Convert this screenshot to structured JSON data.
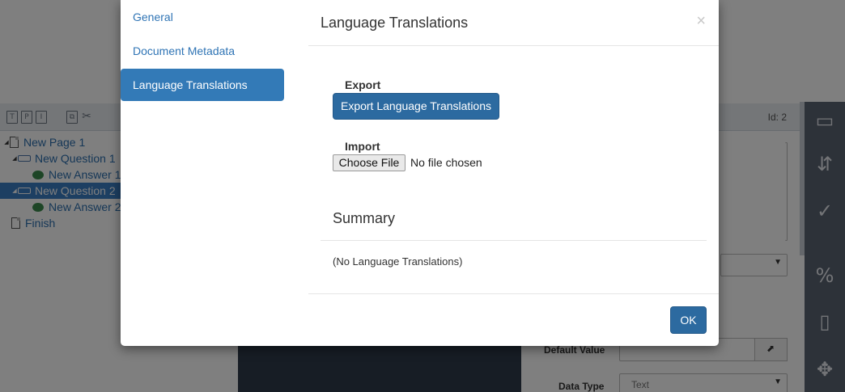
{
  "app": {
    "toolbar": {
      "icons": [
        "T",
        "P",
        "I",
        "copy",
        "cut",
        "T"
      ],
      "id_label": "Id: 2"
    },
    "tree": [
      {
        "label": "New Page 1",
        "type": "page",
        "depth": 0,
        "expanded": true,
        "selected": false
      },
      {
        "label": "New Question 1",
        "type": "question",
        "depth": 1,
        "expanded": true,
        "selected": false
      },
      {
        "label": "New Answer 1",
        "type": "answer",
        "depth": 2,
        "selected": false
      },
      {
        "label": "New Question 2",
        "type": "question",
        "depth": 1,
        "expanded": true,
        "selected": true
      },
      {
        "label": "New Answer 2",
        "type": "answer",
        "depth": 2,
        "selected": false
      },
      {
        "label": "Finish",
        "type": "page",
        "depth": 0,
        "selected": false
      }
    ],
    "form": {
      "default_value_label": "Default Value",
      "data_type_label": "Data Type",
      "data_type_value": "Text"
    },
    "rail_icons": [
      "ellipsis-box-icon",
      "split-arrows-icon",
      "check-circle-icon",
      "variable-icon",
      "bookmark-icon",
      "arrows-expand-icon"
    ]
  },
  "modal": {
    "nav": [
      {
        "label": "General",
        "active": false
      },
      {
        "label": "Document Metadata",
        "active": false
      },
      {
        "label": "Language Translations",
        "active": true
      }
    ],
    "title": "Language Translations",
    "close_glyph": "×",
    "export_label": "Export",
    "export_button": "Export Language Translations",
    "import_label": "Import",
    "choose_file_button": "Choose File",
    "file_status": "No file chosen",
    "summary_title": "Summary",
    "summary_text": "(No Language Translations)",
    "ok_button": "OK"
  },
  "colors": {
    "primary": "#337ab7",
    "primary_dark": "#2c6aa0",
    "overlay": "rgba(0,0,0,0.5)"
  }
}
